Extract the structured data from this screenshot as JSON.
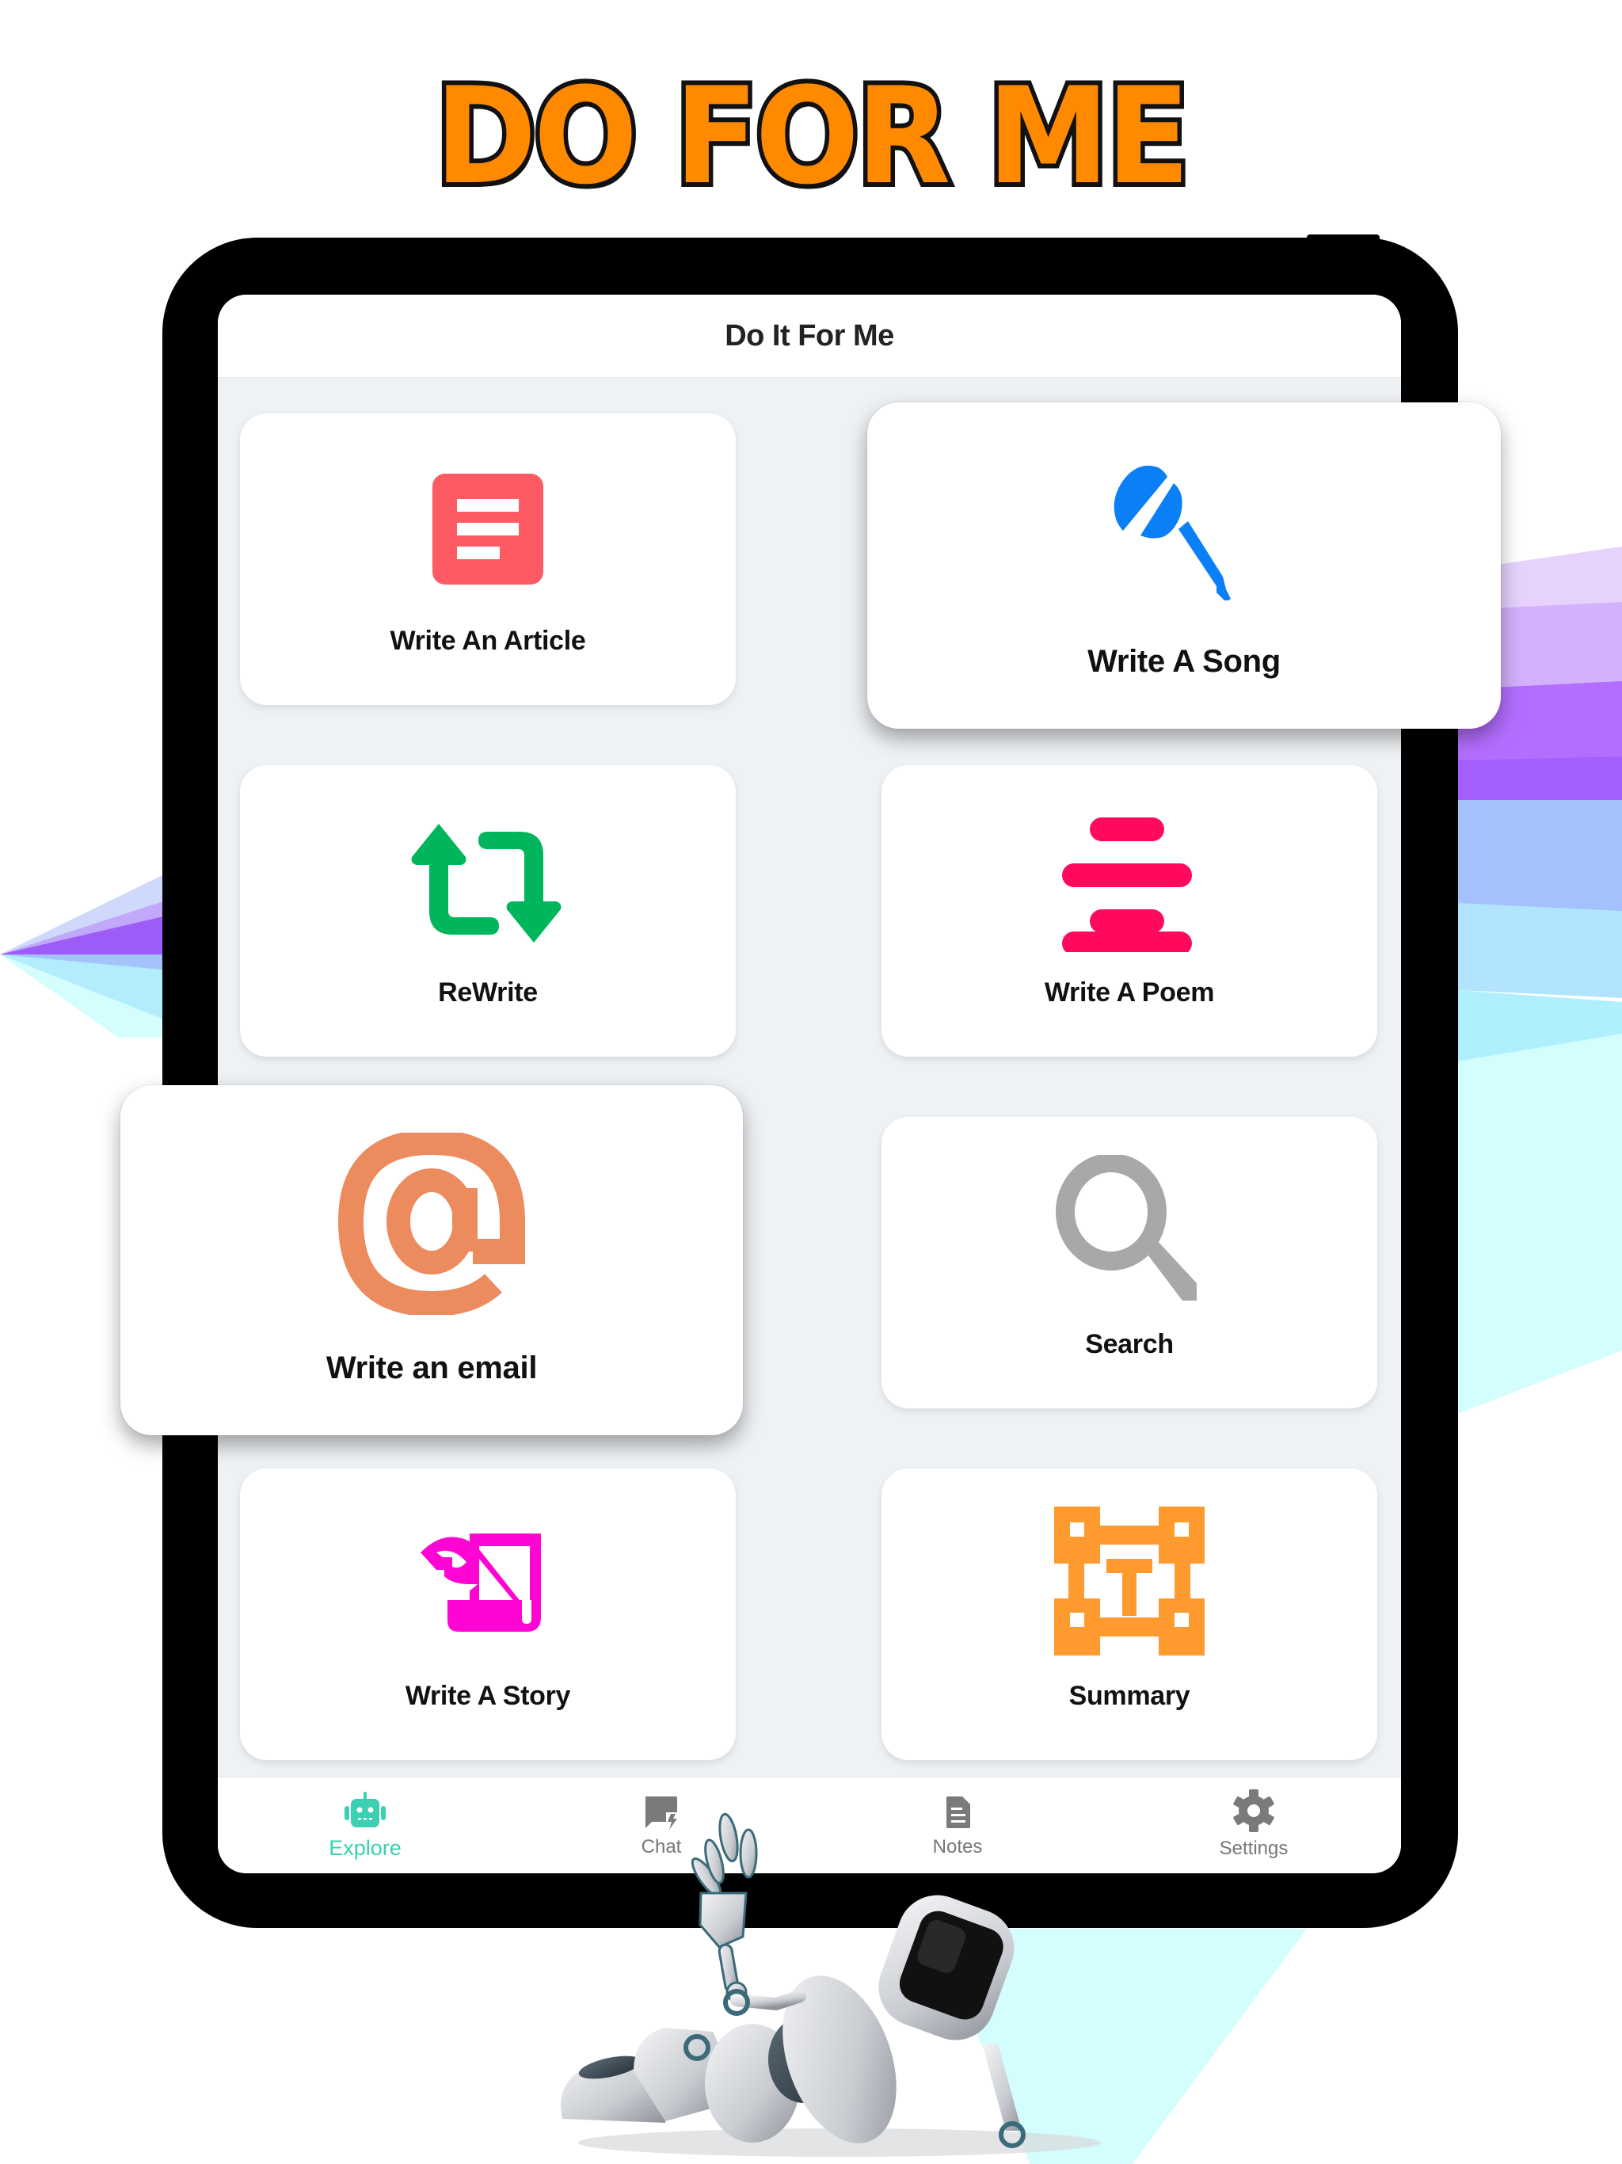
{
  "promo": {
    "headline": "DO FOR ME"
  },
  "app": {
    "title": "Do It For Me"
  },
  "cards": [
    {
      "id": "article",
      "label": "Write An Article",
      "icon": "document-icon",
      "color": "#fe5a63"
    },
    {
      "id": "song",
      "label": "Write A Song",
      "icon": "microphone-icon",
      "color": "#0a7ff6"
    },
    {
      "id": "rewrite",
      "label": "ReWrite",
      "icon": "repeat-arrows-icon",
      "color": "#00b55b"
    },
    {
      "id": "poem",
      "label": "Write A Poem",
      "icon": "text-lines-icon",
      "color": "#ff0a5c"
    },
    {
      "id": "email",
      "label": "Write an email",
      "icon": "at-sign-icon",
      "color": "#ec8b5e"
    },
    {
      "id": "search",
      "label": "Search",
      "icon": "magnifier-icon",
      "color": "#a8a8a8"
    },
    {
      "id": "story",
      "label": "Write A Story",
      "icon": "quill-scroll-icon",
      "color": "#ff05d3"
    },
    {
      "id": "summary",
      "label": "Summary",
      "icon": "text-frame-icon",
      "color": "#ff9a2e"
    }
  ],
  "nav": {
    "active": "Explore",
    "active_color": "#3ccfb1",
    "inactive_color": "#777777",
    "items": [
      {
        "label": "Explore",
        "icon": "robot-icon"
      },
      {
        "label": "Chat",
        "icon": "chat-bolt-icon"
      },
      {
        "label": "Notes",
        "icon": "note-icon"
      },
      {
        "label": "Settings",
        "icon": "gear-icon"
      }
    ]
  },
  "colors": {
    "headline_fill": "#ff8a00",
    "headline_stroke": "#111111",
    "screen_bg": "#eff2f5",
    "bezel": "#000000"
  }
}
